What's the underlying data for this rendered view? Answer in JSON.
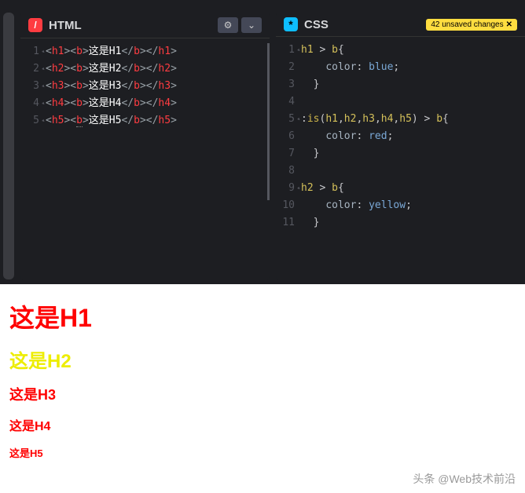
{
  "panels": {
    "html": {
      "title": "HTML",
      "icon_label": "/",
      "lines": [
        {
          "n": 1,
          "tokens": [
            [
              "bracket",
              "<"
            ],
            [
              "tag",
              "h1"
            ],
            [
              "bracket",
              "><"
            ],
            [
              "tag",
              "b"
            ],
            [
              "bracket",
              ">"
            ],
            [
              "text",
              "这是H1"
            ],
            [
              "bracket",
              "</"
            ],
            [
              "tag",
              "b"
            ],
            [
              "bracket",
              "></"
            ],
            [
              "tag",
              "h1"
            ],
            [
              "bracket",
              ">"
            ]
          ]
        },
        {
          "n": 2,
          "tokens": [
            [
              "bracket",
              "<"
            ],
            [
              "tag",
              "h2"
            ],
            [
              "bracket",
              "><"
            ],
            [
              "tag",
              "b"
            ],
            [
              "bracket",
              ">"
            ],
            [
              "text",
              "这是H2"
            ],
            [
              "bracket",
              "</"
            ],
            [
              "tag",
              "b"
            ],
            [
              "bracket",
              "></"
            ],
            [
              "tag",
              "h2"
            ],
            [
              "bracket",
              ">"
            ]
          ]
        },
        {
          "n": 3,
          "tokens": [
            [
              "bracket",
              "<"
            ],
            [
              "tag",
              "h3"
            ],
            [
              "bracket",
              "><"
            ],
            [
              "tag",
              "b"
            ],
            [
              "bracket",
              ">"
            ],
            [
              "text",
              "这是H3"
            ],
            [
              "bracket",
              "</"
            ],
            [
              "tag",
              "b"
            ],
            [
              "bracket",
              "></"
            ],
            [
              "tag",
              "h3"
            ],
            [
              "bracket",
              ">"
            ]
          ]
        },
        {
          "n": 4,
          "tokens": [
            [
              "bracket",
              "<"
            ],
            [
              "tag",
              "h4"
            ],
            [
              "bracket",
              "><"
            ],
            [
              "tag",
              "b"
            ],
            [
              "bracket",
              ">"
            ],
            [
              "text",
              "这是H4"
            ],
            [
              "bracket",
              "</"
            ],
            [
              "tag",
              "b"
            ],
            [
              "bracket",
              "></"
            ],
            [
              "tag",
              "h4"
            ],
            [
              "bracket",
              ">"
            ]
          ]
        },
        {
          "n": 5,
          "tokens": [
            [
              "bracket",
              "<"
            ],
            [
              "tag",
              "h5"
            ],
            [
              "bracket",
              "><"
            ],
            [
              "tag",
              "b",
              "underline-b"
            ],
            [
              "bracket",
              ">"
            ],
            [
              "text",
              "这是H5"
            ],
            [
              "bracket",
              "</"
            ],
            [
              "tag",
              "b"
            ],
            [
              "bracket",
              "></"
            ],
            [
              "tag",
              "h5"
            ],
            [
              "bracket",
              ">"
            ]
          ]
        }
      ]
    },
    "css": {
      "title": "CSS",
      "icon_label": "*",
      "unsaved_label": "42 unsaved changes",
      "lines": [
        {
          "n": 1,
          "tokens": [
            [
              "sel",
              "h1"
            ],
            [
              "punct",
              " > "
            ],
            [
              "sel",
              "b"
            ],
            [
              "brace",
              "{"
            ]
          ]
        },
        {
          "n": 2,
          "tokens": [
            [
              "punct",
              "    "
            ],
            [
              "prop",
              "color"
            ],
            [
              "punct",
              ": "
            ],
            [
              "val-blue",
              "blue"
            ],
            [
              "punct",
              ";"
            ]
          ]
        },
        {
          "n": 3,
          "tokens": [
            [
              "brace",
              "  }"
            ]
          ]
        },
        {
          "n": 4,
          "tokens": []
        },
        {
          "n": 5,
          "tokens": [
            [
              "punct",
              ":"
            ],
            [
              "sel2",
              "is"
            ],
            [
              "punct",
              "("
            ],
            [
              "sel",
              "h1"
            ],
            [
              "punct",
              ","
            ],
            [
              "sel",
              "h2"
            ],
            [
              "punct",
              ","
            ],
            [
              "sel",
              "h3"
            ],
            [
              "punct",
              ","
            ],
            [
              "sel",
              "h4"
            ],
            [
              "punct",
              ","
            ],
            [
              "sel",
              "h5"
            ],
            [
              "punct",
              ") > "
            ],
            [
              "sel",
              "b"
            ],
            [
              "brace",
              "{"
            ]
          ]
        },
        {
          "n": 6,
          "tokens": [
            [
              "punct",
              "    "
            ],
            [
              "prop",
              "color"
            ],
            [
              "punct",
              ": "
            ],
            [
              "val-red",
              "red"
            ],
            [
              "punct",
              ";"
            ]
          ]
        },
        {
          "n": 7,
          "tokens": [
            [
              "brace",
              "  }"
            ]
          ]
        },
        {
          "n": 8,
          "tokens": []
        },
        {
          "n": 9,
          "tokens": [
            [
              "sel",
              "h2"
            ],
            [
              "punct",
              " > "
            ],
            [
              "sel",
              "b"
            ],
            [
              "brace",
              "{"
            ]
          ]
        },
        {
          "n": 10,
          "tokens": [
            [
              "punct",
              "    "
            ],
            [
              "prop",
              "color"
            ],
            [
              "punct",
              ": "
            ],
            [
              "val-yellow",
              "yellow"
            ],
            [
              "punct",
              ";"
            ]
          ]
        },
        {
          "n": 11,
          "tokens": [
            [
              "brace",
              "  }"
            ]
          ]
        }
      ]
    }
  },
  "preview": {
    "h1": "这是H1",
    "h2": "这是H2",
    "h3": "这是H3",
    "h4": "这是H4",
    "h5": "这是H5"
  },
  "watermark": "头条 @Web技术前沿",
  "fold_lines_html": [
    1,
    2,
    3,
    4,
    5
  ],
  "fold_lines_css": [
    1,
    5,
    9
  ]
}
